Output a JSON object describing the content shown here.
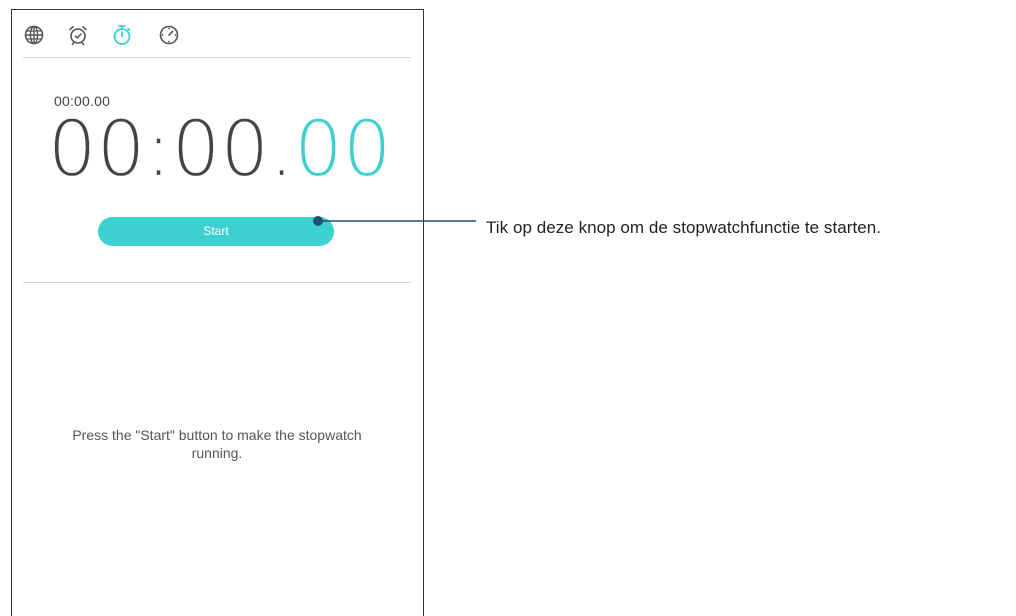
{
  "tabs": [
    {
      "name": "world-clock",
      "icon": "globe-icon",
      "active": false
    },
    {
      "name": "alarm",
      "icon": "alarm-clock-icon",
      "active": false
    },
    {
      "name": "stopwatch",
      "icon": "stopwatch-icon",
      "active": true
    },
    {
      "name": "timer",
      "icon": "timer-icon",
      "active": false
    }
  ],
  "stopwatch": {
    "lap_time": "00:00.00",
    "main_time": "00:00.",
    "main_hundredths": "00",
    "start_label": "Start",
    "hint": "Press the \"Start\" button to make the stopwatch running."
  },
  "callout": {
    "text": "Tik op deze knop om de stopwatchfunctie te starten."
  },
  "colors": {
    "accent": "#3dd0d0",
    "icon_inactive": "#555555",
    "text_dark": "#444444",
    "callout_line": "#1f4e79"
  }
}
